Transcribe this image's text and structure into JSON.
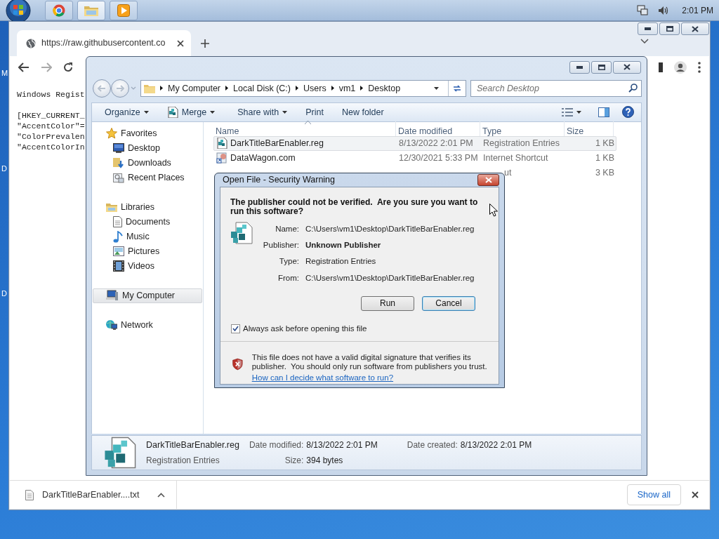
{
  "taskbar": {
    "buttons": [
      {
        "kind": "browser",
        "selected": false
      },
      {
        "kind": "folder",
        "selected": true
      },
      {
        "kind": "media",
        "selected": false
      }
    ],
    "clock": "2:01 PM"
  },
  "desktop_icon_labels": [
    "M",
    "D",
    "D"
  ],
  "browser": {
    "tab_title": "https://raw.githubusercontent.co",
    "page_paragraphs": [
      [
        "Windows Regist"
      ],
      [
        "[HKEY_CURRENT_",
        "\"AccentColor\"=",
        "\"ColorPrevalen",
        "\"AccentColorIn"
      ]
    ],
    "download": {
      "file_name": "DarkTitleBarEnabler....txt",
      "show_all": "Show all"
    }
  },
  "explorer": {
    "breadcrumb": [
      "My Computer",
      "Local Disk (C:)",
      "Users",
      "vm1",
      "Desktop"
    ],
    "search_placeholder": "Search Desktop",
    "toolbar": [
      {
        "label": "Organize",
        "dropdown": true
      },
      {
        "label": "Merge",
        "dropdown": true
      },
      {
        "label": "Share with",
        "dropdown": true
      },
      {
        "label": "Print",
        "dropdown": false
      },
      {
        "label": "New folder",
        "dropdown": false
      }
    ],
    "nav": [
      {
        "label": "Favorites",
        "selected": false,
        "children": [
          {
            "label": "Desktop",
            "selected": false
          },
          {
            "label": "Downloads",
            "selected": false
          },
          {
            "label": "Recent Places",
            "selected": false
          }
        ]
      },
      {
        "label": "Libraries",
        "selected": false,
        "children": [
          {
            "label": "Documents",
            "selected": false
          },
          {
            "label": "Music",
            "selected": false
          },
          {
            "label": "Pictures",
            "selected": false
          },
          {
            "label": "Videos",
            "selected": false
          }
        ]
      },
      {
        "label": "My Computer",
        "selected": true
      },
      {
        "label": "Network",
        "selected": false
      }
    ],
    "columns": [
      {
        "label": "Name",
        "sorted": true
      },
      {
        "label": "Date modified",
        "sorted": false
      },
      {
        "label": "Type",
        "sorted": false
      },
      {
        "label": "Size",
        "sorted": false
      }
    ],
    "files": [
      {
        "kind": "registry",
        "name": "DarkTitleBarEnabler.reg",
        "date_modified": "8/13/2022 2:01 PM",
        "type": "Registration Entries",
        "size": "1 KB",
        "selected": true
      },
      {
        "kind": "shortcut",
        "name": "DataWagon.com",
        "date_modified": "12/30/2021 5:33 PM",
        "type": "Internet Shortcut",
        "size": "1 KB",
        "selected": false
      },
      {
        "type": "ut",
        "size": "3 KB",
        "selected": false
      }
    ],
    "details": {
      "name": "DarkTitleBarEnabler.reg",
      "type": "Registration Entries",
      "fields": [
        {
          "label": "Date modified:",
          "value": "8/13/2022 2:01 PM"
        },
        {
          "label": "Size:",
          "value": "394 bytes"
        },
        {
          "label": "Date created:",
          "value": "8/13/2022 2:01 PM"
        }
      ]
    }
  },
  "dialog": {
    "title": "Open File - Security Warning",
    "heading": "The publisher could not be verified.  Are you sure you want to run this software?",
    "fields": [
      {
        "label": "Name:",
        "value": "C:\\Users\\vm1\\Desktop\\DarkTitleBarEnabler.reg",
        "bold": false
      },
      {
        "label": "Publisher:",
        "value": "Unknown Publisher",
        "bold": true
      },
      {
        "label": "Type:",
        "value": "Registration Entries",
        "bold": false
      },
      {
        "label": "From:",
        "value": "C:\\Users\\vm1\\Desktop\\DarkTitleBarEnabler.reg",
        "bold": false
      }
    ],
    "buttons": [
      {
        "label": "Run",
        "default": false
      },
      {
        "label": "Cancel",
        "default": true
      }
    ],
    "always_ask": {
      "label": "Always ask before opening this file",
      "checked": true
    },
    "warning": "This file does not have a valid digital signature that verifies its publisher.  You should only run software from publishers you trust.",
    "help_link": "How can I decide what software to run?"
  }
}
